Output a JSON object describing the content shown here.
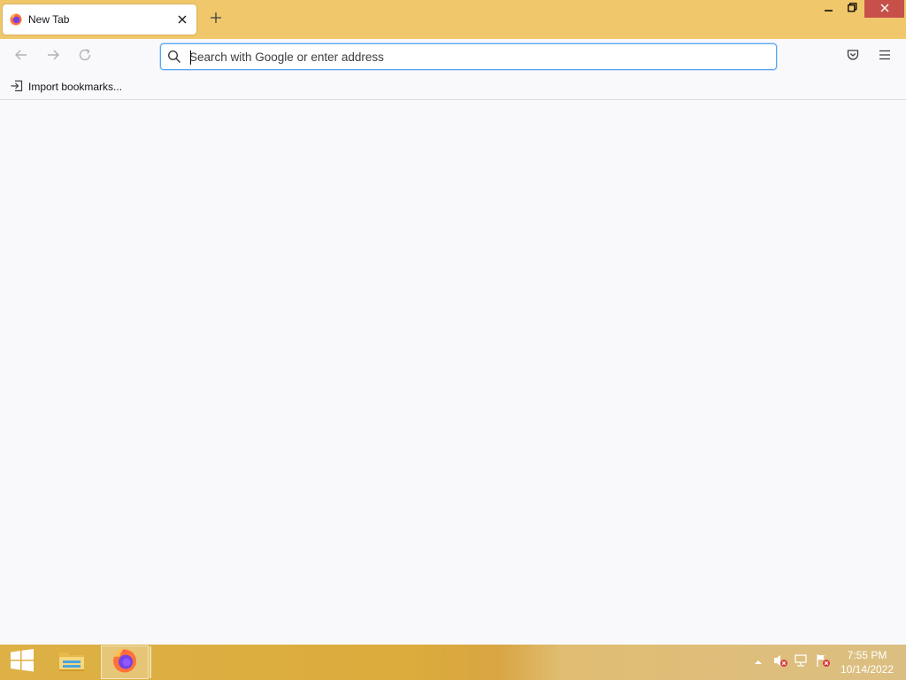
{
  "browser": {
    "tab": {
      "title": "New Tab"
    },
    "urlbar": {
      "placeholder": "Search with Google or enter address",
      "value": ""
    },
    "bookmarks": {
      "import_label": "Import bookmarks..."
    }
  },
  "taskbar": {
    "time": "7:55 PM",
    "date": "10/14/2022"
  },
  "icons": [
    "firefox-icon",
    "close-icon",
    "plus-icon",
    "minimize-icon",
    "restore-icon",
    "back-icon",
    "forward-icon",
    "reload-icon",
    "search-icon",
    "pocket-icon",
    "menu-icon",
    "import-icon",
    "windows-logo-icon",
    "file-explorer-icon",
    "chevron-up-icon",
    "speaker-muted-icon",
    "network-icon",
    "flag-icon"
  ],
  "colors": {
    "titlebar": "#f0c86b",
    "window_close": "#c7504b",
    "focus_ring": "#58a6f4"
  }
}
